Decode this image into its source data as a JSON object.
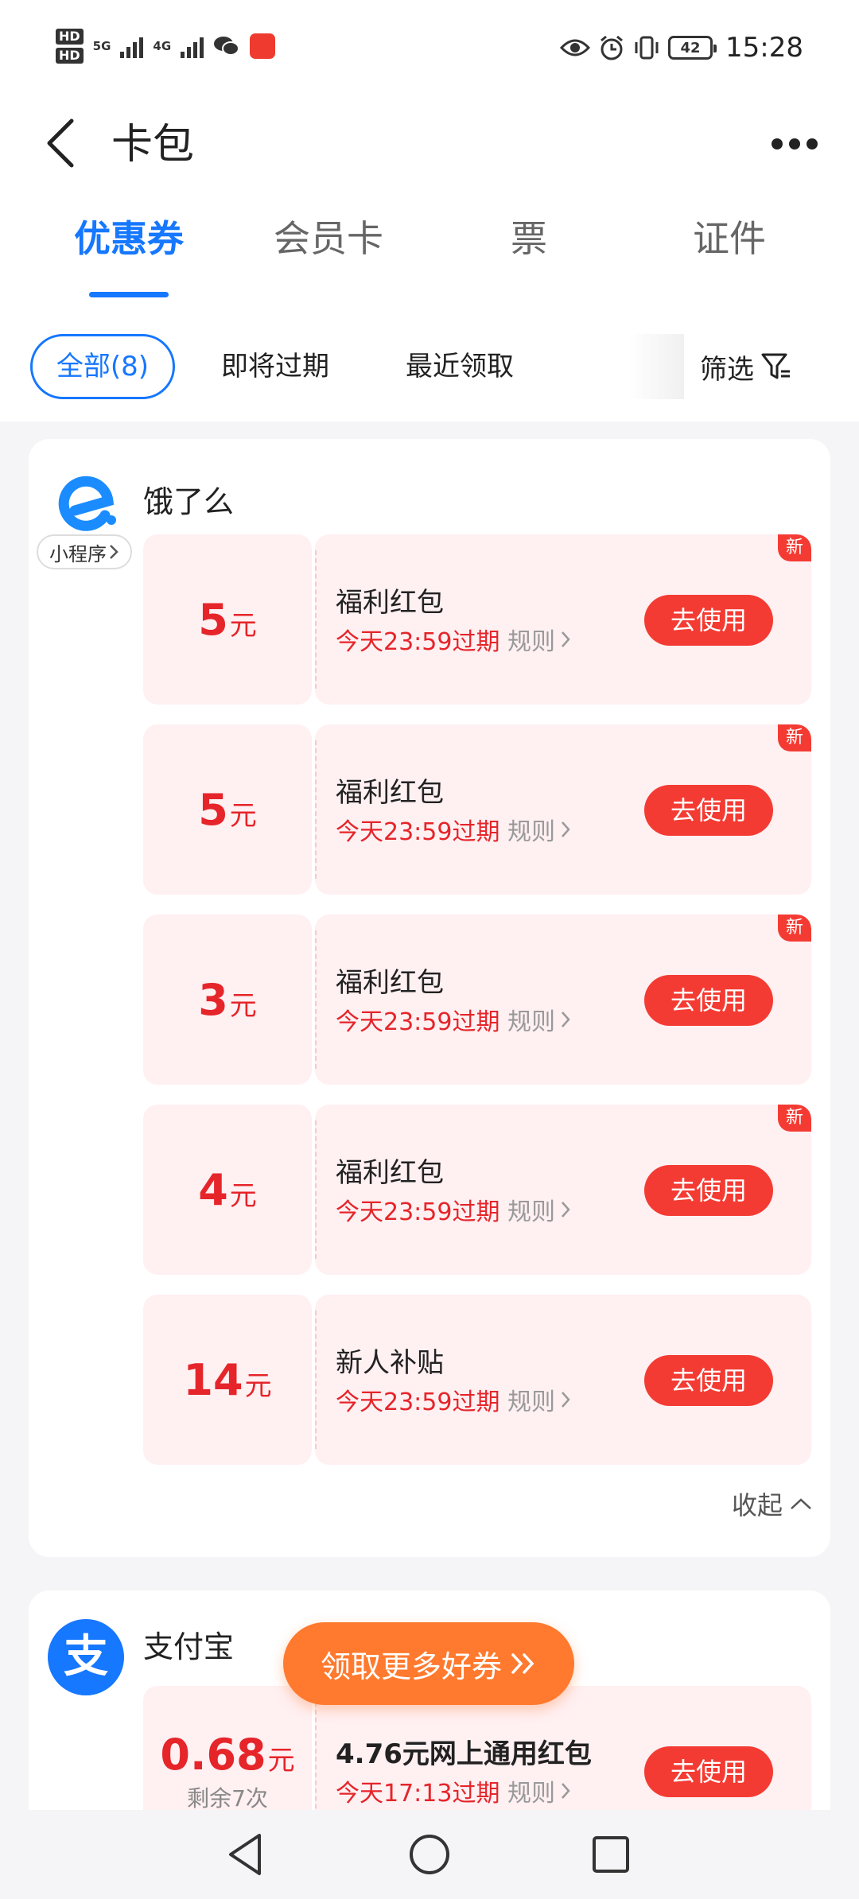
{
  "status_bar": {
    "hd1": "HD",
    "hd2": "HD",
    "sig1": "5G",
    "sig2": "4G",
    "battery": "42",
    "time": "15:28",
    "icons": [
      "eye-icon",
      "alarm-icon",
      "vibrate-icon"
    ]
  },
  "header": {
    "title": "卡包",
    "back_icon": "chevron-left-icon",
    "more_icon": "more-dots-icon"
  },
  "tabs": [
    {
      "label": "优惠券",
      "active": true
    },
    {
      "label": "会员卡",
      "active": false
    },
    {
      "label": "票",
      "active": false
    },
    {
      "label": "证件",
      "active": false
    }
  ],
  "filters": {
    "chips": [
      {
        "label": "全部(8)",
        "active": true
      },
      {
        "label": "即将过期",
        "active": false
      },
      {
        "label": "最近领取",
        "active": false
      }
    ],
    "filter_label": "筛选"
  },
  "eleme": {
    "brand_name": "饿了么",
    "mini_tag": "小程序",
    "coupons": [
      {
        "amount": "5",
        "unit": "元",
        "name": "福利红包",
        "expiry": "今天23:59过期",
        "rules": "规则",
        "button": "去使用",
        "badge": "新"
      },
      {
        "amount": "5",
        "unit": "元",
        "name": "福利红包",
        "expiry": "今天23:59过期",
        "rules": "规则",
        "button": "去使用",
        "badge": "新"
      },
      {
        "amount": "3",
        "unit": "元",
        "name": "福利红包",
        "expiry": "今天23:59过期",
        "rules": "规则",
        "button": "去使用",
        "badge": "新"
      },
      {
        "amount": "4",
        "unit": "元",
        "name": "福利红包",
        "expiry": "今天23:59过期",
        "rules": "规则",
        "button": "去使用",
        "badge": "新"
      },
      {
        "amount": "14",
        "unit": "元",
        "name": "新人补贴",
        "expiry": "今天23:59过期",
        "rules": "规则",
        "button": "去使用"
      }
    ],
    "collapse_label": "收起"
  },
  "alipay": {
    "brand_name": "支付宝",
    "logo_char": "支",
    "coupon": {
      "amount": "0.68",
      "unit": "元",
      "sub": "剩余7次",
      "name": "4.76元网上通用红包",
      "expiry": "今天17:13过期",
      "rules": "规则",
      "button": "去使用"
    }
  },
  "promo": {
    "label": "领取更多好券",
    "icon": "double-chevron-right-icon"
  },
  "nav": [
    "back-triangle-icon",
    "home-circle-icon",
    "recent-square-icon"
  ],
  "colors": {
    "accent": "#1677ff",
    "red": "#e5252a",
    "button_red": "#f43b33",
    "coupon_bg": "#fff0f2",
    "promo": "#ff7a2e"
  }
}
